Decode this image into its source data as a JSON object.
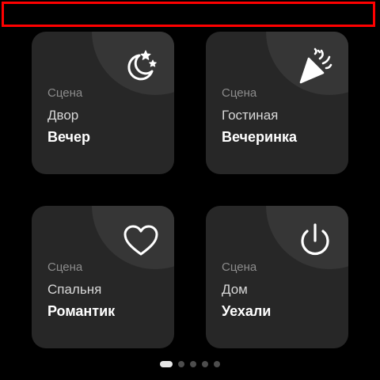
{
  "cards": [
    {
      "kind": "Сцена",
      "room": "Двор",
      "scene": "Вечер",
      "icon": "moon-stars-icon"
    },
    {
      "kind": "Сцена",
      "room": "Гостиная",
      "scene": "Вечеринка",
      "icon": "party-popper-icon"
    },
    {
      "kind": "Сцена",
      "room": "Спальня",
      "scene": "Романтик",
      "icon": "heart-icon"
    },
    {
      "kind": "Сцена",
      "room": "Дом",
      "scene": "Уехали",
      "icon": "power-icon"
    }
  ],
  "pager": {
    "pages": 5,
    "current": 1
  },
  "colors": {
    "background": "#000000",
    "card": "#272727",
    "card_bubble": "#363636",
    "highlight_border": "#ff0000",
    "text_primary": "#ffffff",
    "text_secondary": "#8c8c8c"
  }
}
